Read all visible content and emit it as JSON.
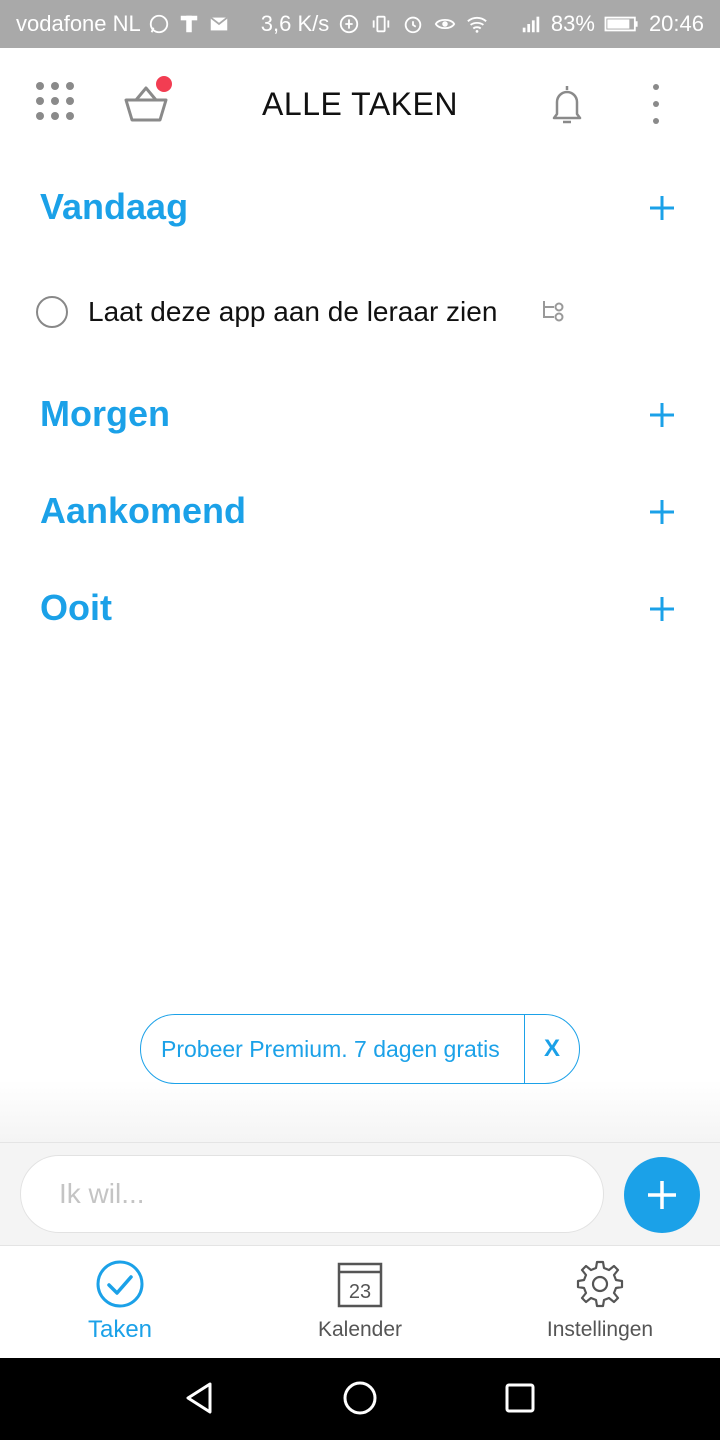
{
  "status_bar": {
    "carrier": "vodafone NL",
    "speed": "3,6 K/s",
    "battery": "83%",
    "time": "20:46"
  },
  "header": {
    "title": "ALLE TAKEN",
    "basket_has_notification": true
  },
  "sections": [
    {
      "title": "Vandaag"
    },
    {
      "title": "Morgen"
    },
    {
      "title": "Aankomend"
    },
    {
      "title": "Ooit"
    }
  ],
  "tasks": [
    {
      "text": "Laat deze app aan de leraar zien",
      "done": false,
      "has_subtasks": true
    }
  ],
  "premium_banner": {
    "text": "Probeer Premium. 7 dagen gratis",
    "close_label": "X"
  },
  "input": {
    "placeholder": "Ik wil...",
    "value": ""
  },
  "bottom_nav": {
    "items": [
      {
        "label": "Taken",
        "active": true
      },
      {
        "label": "Kalender",
        "active": false,
        "day": "23"
      },
      {
        "label": "Instellingen",
        "active": false
      }
    ]
  },
  "colors": {
    "accent": "#1ba1e8",
    "notification": "#f23d52",
    "status_bar": "#a9a9a9"
  }
}
